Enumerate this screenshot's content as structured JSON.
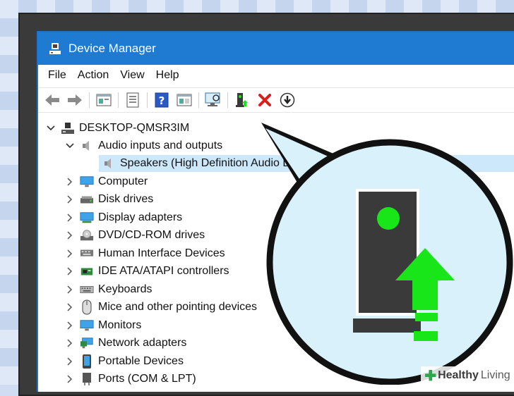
{
  "window": {
    "title": "Device Manager"
  },
  "menu": [
    "File",
    "Action",
    "View",
    "Help"
  ],
  "toolbar": {
    "icons": [
      "back-icon",
      "forward-icon",
      "properties-icon",
      "show-hide-icon",
      "help-icon",
      "view-icon",
      "scan-hardware-icon",
      "update-driver-icon",
      "uninstall-icon",
      "download-icon"
    ]
  },
  "tree": {
    "root": "DESKTOP-QMSR3IM",
    "audio": "Audio inputs and outputs",
    "speakers": "Speakers (High Definition Audio Device)",
    "categories": [
      "Computer",
      "Disk drives",
      "Display adapters",
      "DVD/CD-ROM drives",
      "Human Interface Devices",
      "IDE ATA/ATAPI controllers",
      "Keyboards",
      "Mice and other pointing devices",
      "Monitors",
      "Network adapters",
      "Portable Devices",
      "Ports (COM & LPT)"
    ]
  },
  "zoom": {
    "icon": "update-driver-icon"
  },
  "watermark": {
    "brand_a": "Healthy",
    "brand_b": "Living"
  },
  "colors": {
    "accent": "#1f7ad2",
    "selection": "#cde8fb",
    "green": "#19e619",
    "bubble": "#d9f1fb"
  }
}
